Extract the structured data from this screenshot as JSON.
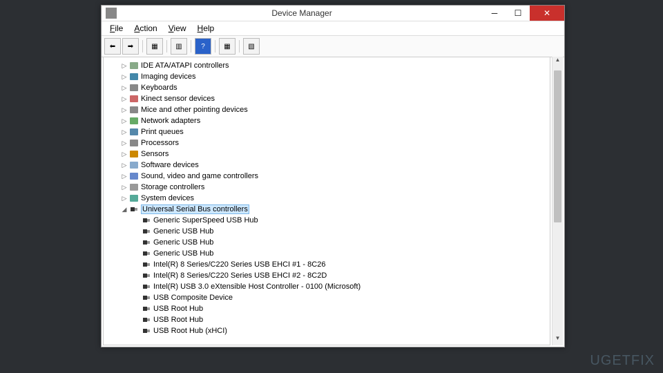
{
  "title": "Device Manager",
  "menus": [
    "File",
    "Action",
    "View",
    "Help"
  ],
  "watermark": "UGETFIX",
  "tree": [
    {
      "indent": 1,
      "arrow": "▷",
      "icon": "ide",
      "label": "IDE ATA/ATAPI controllers"
    },
    {
      "indent": 1,
      "arrow": "▷",
      "icon": "imaging",
      "label": "Imaging devices"
    },
    {
      "indent": 1,
      "arrow": "▷",
      "icon": "keyboard",
      "label": "Keyboards"
    },
    {
      "indent": 1,
      "arrow": "▷",
      "icon": "kinect",
      "label": "Kinect sensor devices"
    },
    {
      "indent": 1,
      "arrow": "▷",
      "icon": "mouse",
      "label": "Mice and other pointing devices"
    },
    {
      "indent": 1,
      "arrow": "▷",
      "icon": "network",
      "label": "Network adapters"
    },
    {
      "indent": 1,
      "arrow": "▷",
      "icon": "printer",
      "label": "Print queues"
    },
    {
      "indent": 1,
      "arrow": "▷",
      "icon": "cpu",
      "label": "Processors"
    },
    {
      "indent": 1,
      "arrow": "▷",
      "icon": "sensor",
      "label": "Sensors"
    },
    {
      "indent": 1,
      "arrow": "▷",
      "icon": "software",
      "label": "Software devices"
    },
    {
      "indent": 1,
      "arrow": "▷",
      "icon": "sound",
      "label": "Sound, video and game controllers"
    },
    {
      "indent": 1,
      "arrow": "▷",
      "icon": "storage",
      "label": "Storage controllers"
    },
    {
      "indent": 1,
      "arrow": "▷",
      "icon": "system",
      "label": "System devices"
    },
    {
      "indent": 1,
      "arrow": "◢",
      "icon": "usb",
      "label": "Universal Serial Bus controllers",
      "selected": true
    },
    {
      "indent": 2,
      "arrow": "",
      "icon": "usb",
      "label": "Generic SuperSpeed USB Hub"
    },
    {
      "indent": 2,
      "arrow": "",
      "icon": "usb",
      "label": "Generic USB Hub"
    },
    {
      "indent": 2,
      "arrow": "",
      "icon": "usb",
      "label": "Generic USB Hub"
    },
    {
      "indent": 2,
      "arrow": "",
      "icon": "usb",
      "label": "Generic USB Hub"
    },
    {
      "indent": 2,
      "arrow": "",
      "icon": "usb",
      "label": "Intel(R) 8 Series/C220 Series USB EHCI #1 - 8C26"
    },
    {
      "indent": 2,
      "arrow": "",
      "icon": "usb",
      "label": "Intel(R) 8 Series/C220 Series USB EHCI #2 - 8C2D"
    },
    {
      "indent": 2,
      "arrow": "",
      "icon": "usb",
      "label": "Intel(R) USB 3.0 eXtensible Host Controller - 0100 (Microsoft)"
    },
    {
      "indent": 2,
      "arrow": "",
      "icon": "usb",
      "label": "USB Composite Device"
    },
    {
      "indent": 2,
      "arrow": "",
      "icon": "usb",
      "label": "USB Root Hub"
    },
    {
      "indent": 2,
      "arrow": "",
      "icon": "usb",
      "label": "USB Root Hub"
    },
    {
      "indent": 2,
      "arrow": "",
      "icon": "usb",
      "label": "USB Root Hub (xHCI)"
    }
  ]
}
